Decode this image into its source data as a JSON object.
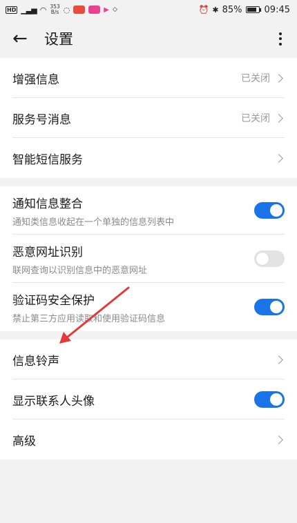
{
  "status_bar": {
    "hd": "HD",
    "network": "4G",
    "speed_value": "353",
    "speed_unit": "B/s",
    "battery": "85%",
    "time": "09:45"
  },
  "toolbar": {
    "title": "设置"
  },
  "groups": [
    [
      {
        "type": "nav",
        "label": "增强信息",
        "value": "已关闭"
      },
      {
        "type": "nav",
        "label": "服务号消息",
        "value": "已关闭"
      },
      {
        "type": "nav",
        "label": "智能短信服务",
        "value": ""
      }
    ],
    [
      {
        "type": "toggle",
        "label": "通知信息整合",
        "sub": "通知类信息收起在一个单独的信息列表中",
        "on": true
      },
      {
        "type": "toggle",
        "label": "恶意网址识别",
        "sub": "联网查询以识别信息中的恶意网址",
        "on": false
      },
      {
        "type": "toggle",
        "label": "验证码安全保护",
        "sub": "禁止第三方应用读取和使用验证码信息",
        "on": true
      }
    ],
    [
      {
        "type": "nav",
        "label": "信息铃声",
        "value": ""
      },
      {
        "type": "toggle",
        "label": "显示联系人头像",
        "sub": "",
        "on": true
      },
      {
        "type": "nav",
        "label": "高级",
        "value": ""
      }
    ]
  ],
  "colors": {
    "accent": "#1a73e8",
    "annotation_arrow": "#e03a3a"
  }
}
